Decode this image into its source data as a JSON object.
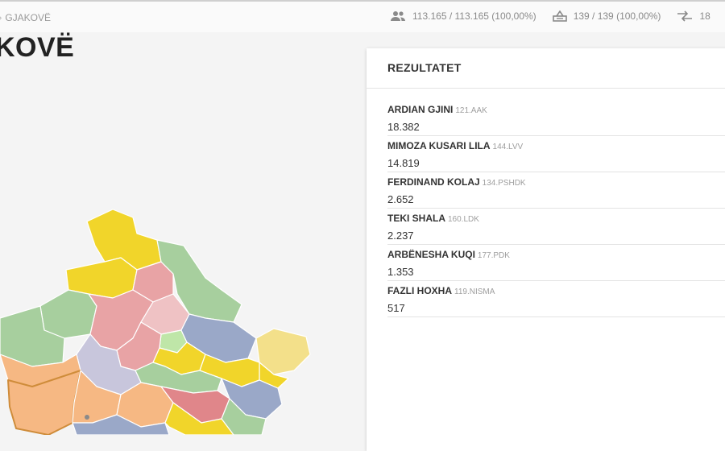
{
  "breadcrumb": {
    "current": "GJAKOVË"
  },
  "stats": [
    {
      "icon": "voters-icon",
      "text": "113.165 / 113.165 (100,00%)"
    },
    {
      "icon": "ballot-box-icon",
      "text": "139 / 139 (100,00%)"
    },
    {
      "icon": "turnout-icon",
      "text": "18"
    }
  ],
  "page": {
    "title": "KOVË"
  },
  "results": {
    "title": "REZULTATET",
    "candidates": [
      {
        "name": "ARDIAN GJINI",
        "party": "121.AAK",
        "votes": "18.382"
      },
      {
        "name": "MIMOZA KUSARI LILA",
        "party": "144.LVV",
        "votes": "14.819"
      },
      {
        "name": "FERDINAND KOLAJ",
        "party": "134.PSHDK",
        "votes": "2.652"
      },
      {
        "name": "TEKI SHALA",
        "party": "160.LDK",
        "votes": "2.237"
      },
      {
        "name": "ARBËNESHA KUQI",
        "party": "177.PDK",
        "votes": "1.353"
      },
      {
        "name": "FAZLI HOXHA",
        "party": "119.NISMA",
        "votes": "517"
      }
    ]
  },
  "map": {
    "colors": {
      "AAK": "#f6b883",
      "LVV": "#e8a3a5",
      "LDK": "#f1d52a",
      "PDK": "#9aa8c8",
      "NISMA": "#a7cf9e",
      "other": "#f3e08a",
      "highlight": "#cf8c3a"
    }
  }
}
